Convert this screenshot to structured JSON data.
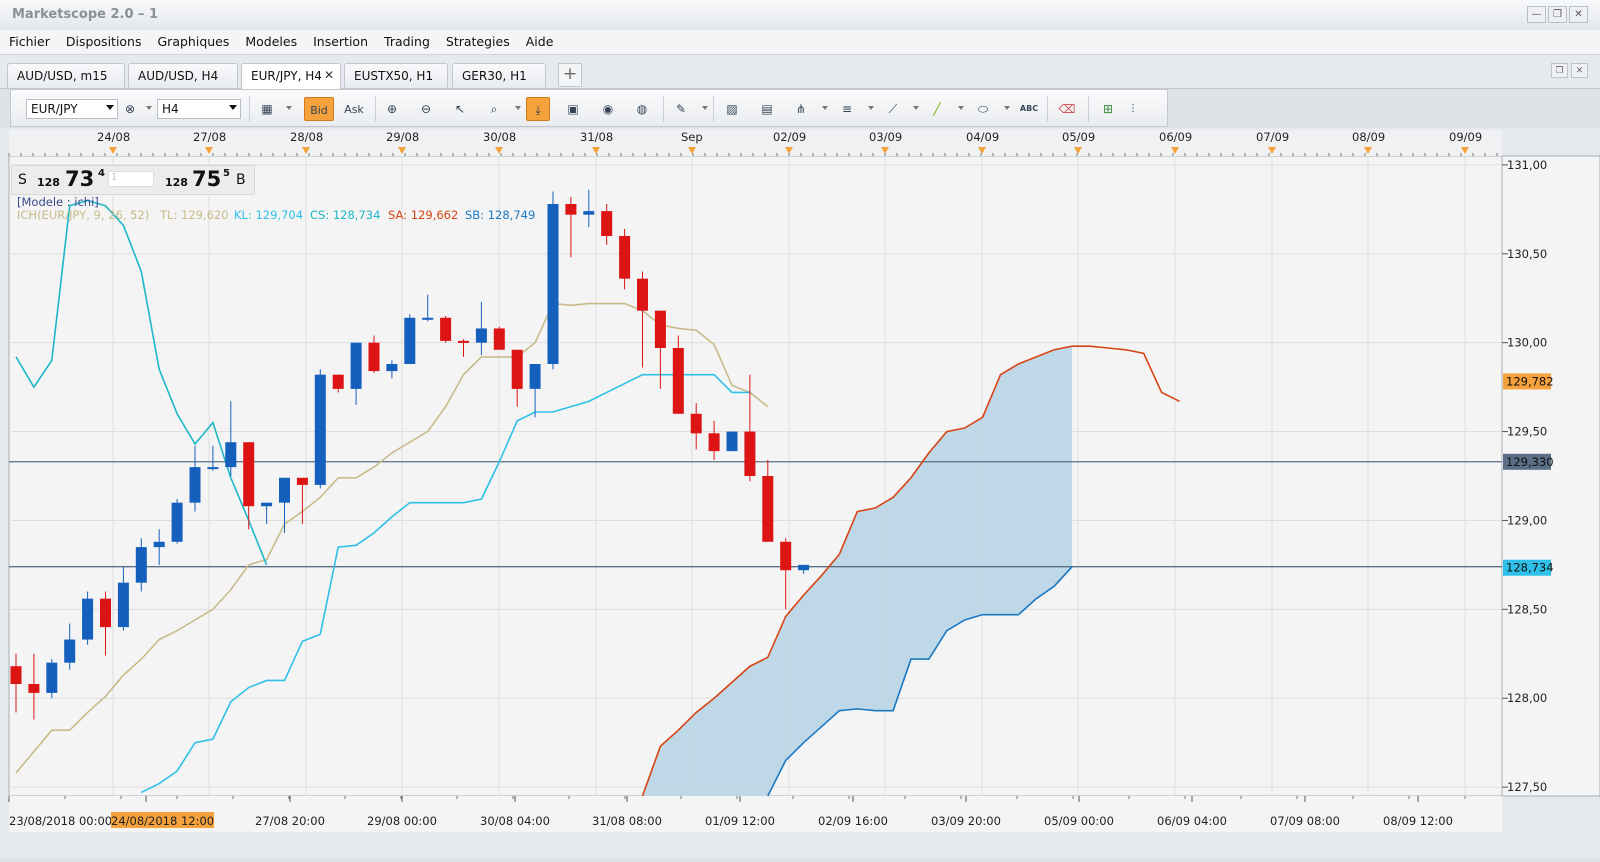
{
  "window": {
    "title": "Marketscope 2.0 – 1"
  },
  "menu": [
    "Fichier",
    "Dispositions",
    "Graphiques",
    "Modeles",
    "Insertion",
    "Trading",
    "Strategies",
    "Aide"
  ],
  "tabs": [
    {
      "label": "AUD/USD, m15",
      "active": false
    },
    {
      "label": "AUD/USD, H4",
      "active": false
    },
    {
      "label": "EUR/JPY, H4",
      "active": true
    },
    {
      "label": "EUSTX50, H1",
      "active": false
    },
    {
      "label": "GER30, H1",
      "active": false
    }
  ],
  "toolbar": {
    "symbol": "EUR/JPY",
    "timeframe": "H4",
    "bid_label": "Bid",
    "ask_label": "Ask",
    "text_tool_label": "ABC"
  },
  "quote": {
    "sell_label": "S",
    "sell_big": "128",
    "sell_main": "73",
    "sell_sup": "4",
    "amount": "1",
    "buy_big": "128",
    "buy_main": "75",
    "buy_sup": "5",
    "buy_label": "B"
  },
  "indicator": {
    "model": "[Modele : ichi]",
    "name": "ICH(EUR/JPY, 9, 26, 52)",
    "tl": "TL: 129,620",
    "kl": "KL: 129,704",
    "cs": "CS: 128,734",
    "sa": "SA: 129,662",
    "sb": "SB: 128,749"
  },
  "colors": {
    "bull": "#1560bd",
    "bear": "#dc1414",
    "tenkan": "#c8bb8a",
    "kijun": "#2ec0e8",
    "chikou": "#1cb8c8",
    "senkou_a": "#d84414",
    "senkou_b": "#1a78c2",
    "cloud": "#bcd6e6",
    "hline": "#5a6e86",
    "accent": "#f5a13c"
  },
  "chart_data": {
    "type": "candlestick",
    "ylim": [
      127.45,
      131.05
    ],
    "y_ticks": [
      "131,00",
      "130,50",
      "130,00",
      "129,50",
      "129,00",
      "128,50",
      "128,00",
      "127,50"
    ],
    "y_tick_values": [
      131.0,
      130.5,
      130.0,
      129.5,
      129.0,
      128.5,
      128.0,
      127.5
    ],
    "top_date_labels": [
      "24/08",
      "27/08",
      "28/08",
      "29/08",
      "30/08",
      "31/08",
      "Sep",
      "02/09",
      "03/09",
      "04/09",
      "05/09",
      "06/09",
      "07/09",
      "08/09",
      "09/09"
    ],
    "bottom_time_labels": [
      "23/08/2018 00:00",
      "24/08/2018 12:00",
      "27/08 20:00",
      "29/08 00:00",
      "30/08 04:00",
      "31/08 08:00",
      "01/09 12:00",
      "02/09 16:00",
      "03/09 20:00",
      "05/09 00:00",
      "06/09 04:00",
      "07/09 08:00",
      "08/09 12:00"
    ],
    "highlighted_time": "24/08/2018 12:00",
    "price_markers": [
      {
        "label": "129,782",
        "value": 129.782,
        "color": "#f5a13c"
      },
      {
        "label": "129,330",
        "value": 129.33,
        "color": "#5a6e86"
      },
      {
        "label": "128,734",
        "value": 128.734,
        "color": "#2ec0e8"
      }
    ],
    "horizontal_lines": [
      129.33,
      128.74
    ],
    "candles": [
      {
        "o": 128.18,
        "h": 128.25,
        "l": 127.92,
        "c": 128.08
      },
      {
        "o": 128.08,
        "h": 128.25,
        "l": 127.88,
        "c": 128.03
      },
      {
        "o": 128.03,
        "h": 128.22,
        "l": 128.0,
        "c": 128.2
      },
      {
        "o": 128.2,
        "h": 128.42,
        "l": 128.16,
        "c": 128.33
      },
      {
        "o": 128.33,
        "h": 128.6,
        "l": 128.3,
        "c": 128.56
      },
      {
        "o": 128.56,
        "h": 128.6,
        "l": 128.24,
        "c": 128.4
      },
      {
        "o": 128.4,
        "h": 128.74,
        "l": 128.38,
        "c": 128.65
      },
      {
        "o": 128.65,
        "h": 128.9,
        "l": 128.6,
        "c": 128.85
      },
      {
        "o": 128.85,
        "h": 128.95,
        "l": 128.75,
        "c": 128.88
      },
      {
        "o": 128.88,
        "h": 129.12,
        "l": 128.87,
        "c": 129.1
      },
      {
        "o": 129.1,
        "h": 129.42,
        "l": 129.05,
        "c": 129.3
      },
      {
        "o": 129.3,
        "h": 129.42,
        "l": 129.28,
        "c": 129.3
      },
      {
        "o": 129.3,
        "h": 129.67,
        "l": 129.25,
        "c": 129.44
      },
      {
        "o": 129.44,
        "h": 129.44,
        "l": 128.95,
        "c": 129.08
      },
      {
        "o": 129.08,
        "h": 129.1,
        "l": 128.98,
        "c": 129.1
      },
      {
        "o": 129.1,
        "h": 129.24,
        "l": 128.93,
        "c": 129.24
      },
      {
        "o": 129.24,
        "h": 129.22,
        "l": 128.98,
        "c": 129.2
      },
      {
        "o": 129.2,
        "h": 129.85,
        "l": 129.18,
        "c": 129.82
      },
      {
        "o": 129.82,
        "h": 129.82,
        "l": 129.72,
        "c": 129.74
      },
      {
        "o": 129.74,
        "h": 130.0,
        "l": 129.65,
        "c": 130.0
      },
      {
        "o": 130.0,
        "h": 130.04,
        "l": 129.83,
        "c": 129.84
      },
      {
        "o": 129.84,
        "h": 129.9,
        "l": 129.8,
        "c": 129.88
      },
      {
        "o": 129.88,
        "h": 130.16,
        "l": 129.88,
        "c": 130.14
      },
      {
        "o": 130.14,
        "h": 130.27,
        "l": 130.12,
        "c": 130.14
      },
      {
        "o": 130.14,
        "h": 130.15,
        "l": 130.0,
        "c": 130.01
      },
      {
        "o": 130.01,
        "h": 130.02,
        "l": 129.92,
        "c": 130.0
      },
      {
        "o": 130.0,
        "h": 130.23,
        "l": 129.93,
        "c": 130.08
      },
      {
        "o": 130.08,
        "h": 130.09,
        "l": 130.0,
        "c": 129.96
      },
      {
        "o": 129.96,
        "h": 129.96,
        "l": 129.64,
        "c": 129.74
      },
      {
        "o": 129.74,
        "h": 129.76,
        "l": 129.58,
        "c": 129.88
      },
      {
        "o": 129.88,
        "h": 130.85,
        "l": 129.85,
        "c": 130.78
      },
      {
        "o": 130.78,
        "h": 130.82,
        "l": 130.48,
        "c": 130.72
      },
      {
        "o": 130.72,
        "h": 130.86,
        "l": 130.65,
        "c": 130.74
      },
      {
        "o": 130.74,
        "h": 130.78,
        "l": 130.55,
        "c": 130.6
      },
      {
        "o": 130.6,
        "h": 130.64,
        "l": 130.3,
        "c": 130.36
      },
      {
        "o": 130.36,
        "h": 130.4,
        "l": 129.86,
        "c": 130.18
      },
      {
        "o": 130.18,
        "h": 130.18,
        "l": 129.74,
        "c": 129.97
      },
      {
        "o": 129.97,
        "h": 130.04,
        "l": 129.6,
        "c": 129.6
      },
      {
        "o": 129.6,
        "h": 129.66,
        "l": 129.4,
        "c": 129.49
      },
      {
        "o": 129.49,
        "h": 129.56,
        "l": 129.34,
        "c": 129.39
      },
      {
        "o": 129.39,
        "h": 129.5,
        "l": 129.39,
        "c": 129.5
      },
      {
        "o": 129.5,
        "h": 129.82,
        "l": 129.22,
        "c": 129.25
      },
      {
        "o": 129.25,
        "h": 129.34,
        "l": 128.92,
        "c": 128.88
      },
      {
        "o": 128.88,
        "h": 128.9,
        "l": 128.5,
        "c": 128.72
      },
      {
        "o": 128.72,
        "h": 128.75,
        "l": 128.7,
        "c": 128.75
      }
    ],
    "tenkan": [
      [
        0,
        127.58
      ],
      [
        2,
        127.82
      ],
      [
        3,
        127.82
      ],
      [
        4,
        127.92
      ],
      [
        5,
        128.01
      ],
      [
        6,
        128.13
      ],
      [
        7,
        128.22
      ],
      [
        8,
        128.33
      ],
      [
        9,
        128.38
      ],
      [
        10,
        128.44
      ],
      [
        11,
        128.5
      ],
      [
        12,
        128.61
      ],
      [
        13,
        128.75
      ],
      [
        14,
        128.78
      ],
      [
        15,
        128.98
      ],
      [
        16,
        129.05
      ],
      [
        17,
        129.13
      ],
      [
        18,
        129.24
      ],
      [
        19,
        129.24
      ],
      [
        20,
        129.3
      ],
      [
        21,
        129.38
      ],
      [
        22,
        129.44
      ],
      [
        23,
        129.5
      ],
      [
        24,
        129.64
      ],
      [
        25,
        129.82
      ],
      [
        26,
        129.92
      ],
      [
        27,
        129.92
      ],
      [
        28,
        129.92
      ],
      [
        29,
        130.0
      ],
      [
        30,
        130.22
      ],
      [
        31,
        130.21
      ],
      [
        32,
        130.22
      ],
      [
        33,
        130.22
      ],
      [
        34,
        130.22
      ],
      [
        35,
        130.18
      ],
      [
        36,
        130.1
      ],
      [
        37,
        130.08
      ],
      [
        38,
        130.07
      ],
      [
        39,
        129.99
      ],
      [
        40,
        129.76
      ],
      [
        41,
        129.72
      ],
      [
        42,
        129.64
      ]
    ],
    "kijun": [
      [
        7,
        127.47
      ],
      [
        8,
        127.52
      ],
      [
        9,
        127.59
      ],
      [
        10,
        127.75
      ],
      [
        11,
        127.77
      ],
      [
        12,
        127.98
      ],
      [
        13,
        128.06
      ],
      [
        14,
        128.1
      ],
      [
        15,
        128.1
      ],
      [
        16,
        128.32
      ],
      [
        17,
        128.36
      ],
      [
        18,
        128.85
      ],
      [
        19,
        128.86
      ],
      [
        20,
        128.93
      ],
      [
        21,
        129.02
      ],
      [
        22,
        129.1
      ],
      [
        23,
        129.1
      ],
      [
        24,
        129.1
      ],
      [
        25,
        129.1
      ],
      [
        26,
        129.12
      ],
      [
        27,
        129.33
      ],
      [
        28,
        129.56
      ],
      [
        29,
        129.61
      ],
      [
        30,
        129.61
      ],
      [
        31,
        129.64
      ],
      [
        32,
        129.67
      ],
      [
        33,
        129.72
      ],
      [
        34,
        129.77
      ],
      [
        35,
        129.82
      ],
      [
        36,
        129.82
      ],
      [
        37,
        129.82
      ],
      [
        38,
        129.82
      ],
      [
        39,
        129.82
      ],
      [
        40,
        129.72
      ],
      [
        41,
        129.72
      ]
    ],
    "chikou": [
      [
        0,
        129.92
      ],
      [
        1,
        129.75
      ],
      [
        2,
        129.9
      ],
      [
        3,
        130.77
      ],
      [
        4,
        130.8
      ],
      [
        5,
        130.77
      ],
      [
        6,
        130.66
      ],
      [
        7,
        130.4
      ],
      [
        8,
        129.85
      ],
      [
        9,
        129.6
      ],
      [
        10,
        129.43
      ],
      [
        11,
        129.55
      ],
      [
        12,
        129.24
      ],
      [
        13,
        129.0
      ],
      [
        14,
        128.75
      ]
    ],
    "senkou_a": [
      [
        35,
        127.45
      ],
      [
        36,
        127.73
      ],
      [
        37,
        127.82
      ],
      [
        38,
        127.92
      ],
      [
        39,
        128.0
      ],
      [
        40,
        128.09
      ],
      [
        41,
        128.18
      ],
      [
        42,
        128.23
      ],
      [
        43,
        128.46
      ],
      [
        44,
        128.58
      ],
      [
        45,
        128.69
      ],
      [
        46,
        128.81
      ],
      [
        47,
        129.05
      ],
      [
        48,
        129.07
      ],
      [
        49,
        129.13
      ],
      [
        50,
        129.24
      ],
      [
        51,
        129.38
      ],
      [
        52,
        129.5
      ],
      [
        53,
        129.52
      ],
      [
        54,
        129.58
      ],
      [
        55,
        129.82
      ],
      [
        56,
        129.88
      ],
      [
        57,
        129.92
      ],
      [
        58,
        129.96
      ],
      [
        59,
        129.98
      ],
      [
        60,
        129.98
      ],
      [
        61,
        129.97
      ],
      [
        62,
        129.96
      ],
      [
        63,
        129.94
      ],
      [
        64,
        129.72
      ],
      [
        65,
        129.67
      ]
    ],
    "senkou_b": [
      [
        42,
        127.45
      ],
      [
        43,
        127.65
      ],
      [
        44,
        127.75
      ],
      [
        45,
        127.84
      ],
      [
        46,
        127.93
      ],
      [
        47,
        127.94
      ],
      [
        48,
        127.93
      ],
      [
        49,
        127.93
      ],
      [
        50,
        128.22
      ],
      [
        51,
        128.22
      ],
      [
        52,
        128.38
      ],
      [
        53,
        128.44
      ],
      [
        54,
        128.47
      ],
      [
        55,
        128.47
      ],
      [
        56,
        128.47
      ],
      [
        57,
        128.56
      ],
      [
        58,
        128.63
      ],
      [
        59,
        128.74
      ]
    ],
    "cloud_x_range": [
      35,
      59
    ]
  }
}
